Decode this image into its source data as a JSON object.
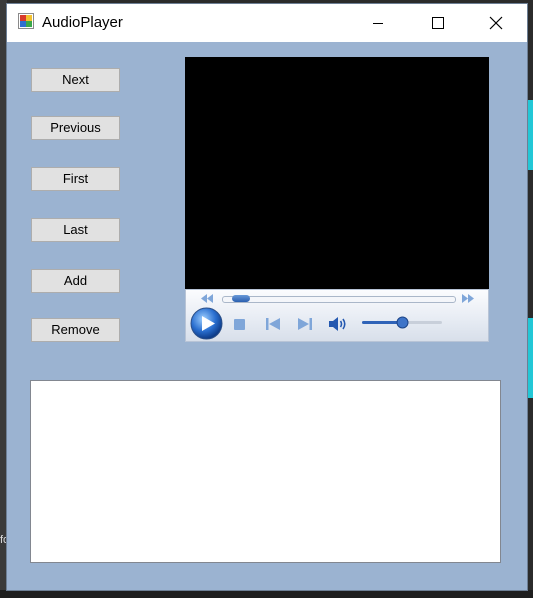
{
  "window": {
    "title": "AudioPlayer"
  },
  "title_controls": {
    "minimize": "minimize-icon",
    "maximize": "maximize-icon",
    "close": "close-icon"
  },
  "buttons": {
    "next": "Next",
    "previous": "Previous",
    "first": "First",
    "last": "Last",
    "add": "Add",
    "remove": "Remove"
  },
  "media_player": {
    "seek_position": 0.08,
    "volume_level": 0.5,
    "icons": [
      "rewind-icon",
      "fast-forward-icon",
      "play-icon",
      "stop-icon",
      "previous-track-icon",
      "next-track-icon",
      "volume-icon"
    ]
  },
  "playlist": {
    "items": []
  },
  "background": {
    "left_fragment": "fo"
  },
  "colors": {
    "form_background": "#9bb3d1",
    "video_background": "#000000",
    "accent_blue": "#2f63b8"
  }
}
